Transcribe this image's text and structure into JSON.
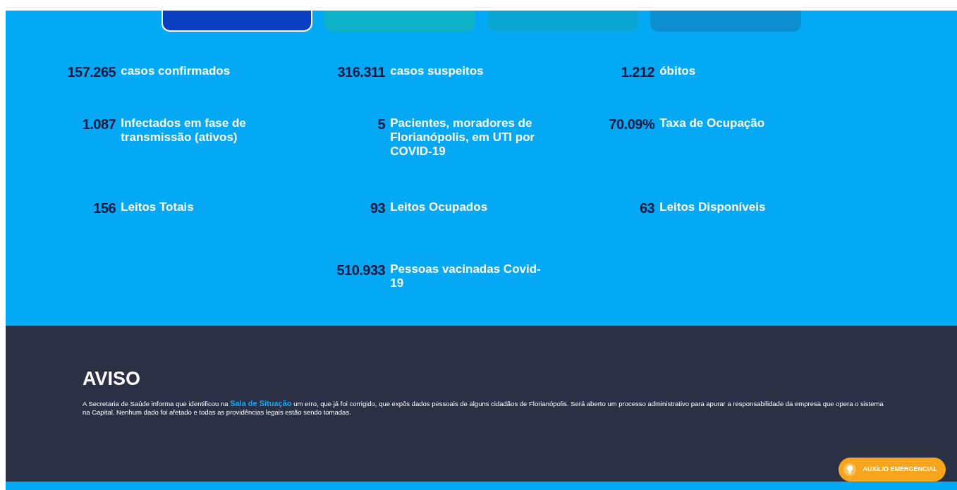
{
  "tabs": [
    {
      "selected": true,
      "color": "#0a3fc4"
    },
    {
      "selected": false,
      "color": "#0db3c9"
    },
    {
      "selected": false,
      "color": "#0aa7d4"
    },
    {
      "selected": false,
      "color": "#0b8fd0"
    }
  ],
  "stats": [
    {
      "kind": "grid",
      "items": [
        {
          "number": "157.265",
          "label": "casos confirmados"
        },
        {
          "number": "316.311",
          "label": "casos suspeitos"
        },
        {
          "number": "1.212",
          "label": "óbitos"
        }
      ]
    },
    {
      "kind": "grid",
      "items": [
        {
          "number": "1.087",
          "label": "Infectados em fase de transmissão (ativos)"
        },
        {
          "number": "5",
          "label": "Pacientes, moradores de Florianópolis, em UTI por COVID-19"
        },
        {
          "number": "70.09%",
          "label": "Taxa de Ocupação"
        }
      ]
    },
    {
      "kind": "grid",
      "items": [
        {
          "number": "156",
          "label": "Leitos Totais"
        },
        {
          "number": "93",
          "label": "Leitos Ocupados"
        },
        {
          "number": "63",
          "label": "Leitos Disponíveis"
        }
      ]
    },
    {
      "kind": "centered",
      "items": [
        {
          "number": "510.933",
          "label": "Pessoas vacinadas Covid-19"
        }
      ]
    }
  ],
  "notice": {
    "title": "AVISO",
    "text_before": "A Secretaria de Saúde informa que identificou na",
    "link": "Sala de Situação",
    "text_after": "um erro, que já foi corrigido, que expôs dados pessoais de alguns cidadãos de Florianópolis. Será aberto um processo administrativo para apurar a responsabilidade da empresa que opera o sistema na Capital. Nenhum dado foi afetado e todas as providências legais estão sendo tomadas."
  },
  "help_button": "AUXÍLIO EMERGENCIAL"
}
